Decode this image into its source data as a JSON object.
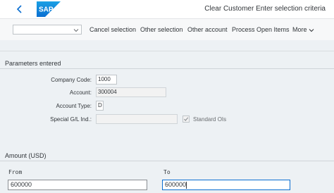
{
  "header": {
    "title": "Clear Customer Enter selection criteria",
    "logo_text": "SAP"
  },
  "toolbar": {
    "variant_value": "",
    "buttons": [
      "Cancel selection",
      "Other selection",
      "Other account",
      "Process Open Items",
      "More"
    ]
  },
  "parameters": {
    "section_title": "Parameters entered",
    "company_code": {
      "label": "Company Code:",
      "value": "1000"
    },
    "account": {
      "label": "Account:",
      "value": "300004"
    },
    "account_type": {
      "label": "Account Type:",
      "value": "D"
    },
    "special_gl": {
      "label": "Special G/L Ind.:",
      "value": ""
    },
    "standard_ois": {
      "label": "Standard OIs",
      "checked": true
    }
  },
  "amount": {
    "section_title": "Amount (USD)",
    "from_label": "From",
    "to_label": "To",
    "from_value": "600000",
    "to_value": "600000"
  },
  "colors": {
    "accent": "#0a6ed1",
    "background": "#edf1f4"
  },
  "icons": {
    "back": "chevron-left-icon",
    "variant_dropdown": "chevron-down-icon",
    "more_dropdown": "chevron-down-icon",
    "checkbox": "checkmark-icon"
  }
}
